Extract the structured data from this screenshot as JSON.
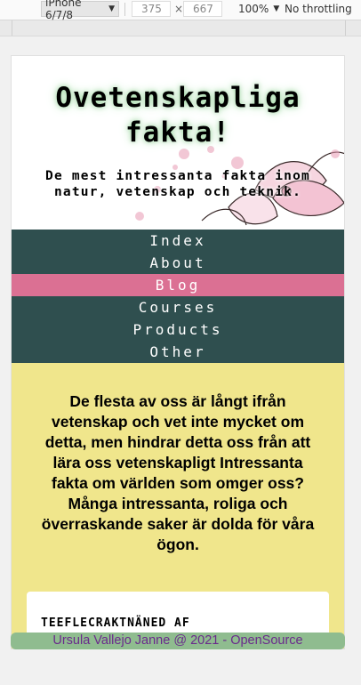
{
  "devtools": {
    "device": "iPhone 6/7/8",
    "width": "375",
    "times": "×",
    "height": "667",
    "zoom": "100%",
    "throttling": "No throttling"
  },
  "site": {
    "title": "Ovetenskapliga fakta!",
    "tagline": "De mest intressanta fakta inom natur, vetenskap och teknik."
  },
  "nav": [
    {
      "label": "Index",
      "active": false
    },
    {
      "label": "About",
      "active": false
    },
    {
      "label": "Blog",
      "active": true
    },
    {
      "label": "Courses",
      "active": false
    },
    {
      "label": "Products",
      "active": false
    },
    {
      "label": "Other",
      "active": false
    }
  ],
  "main": {
    "intro": "De flesta av oss är långt ifrån vetenskap och vet inte mycket om detta, men hindrar detta oss från att lära oss vetenskapligt Intressanta fakta om världen som omger oss? Många intressanta, roliga och överraskande saker är dolda för våra ögon.",
    "card_heading": "TEEFLECRAKTNÄNED AF"
  },
  "footer": {
    "text": "Ursula Vallejo Janne @ 2021 - OpenSource"
  },
  "colors": {
    "nav_bg": "#2f4f4f",
    "nav_active": "#db7093",
    "main_bg": "#f0e68c",
    "footer_bg": "#8fbc8f",
    "footer_text": "#6a2a8c"
  }
}
